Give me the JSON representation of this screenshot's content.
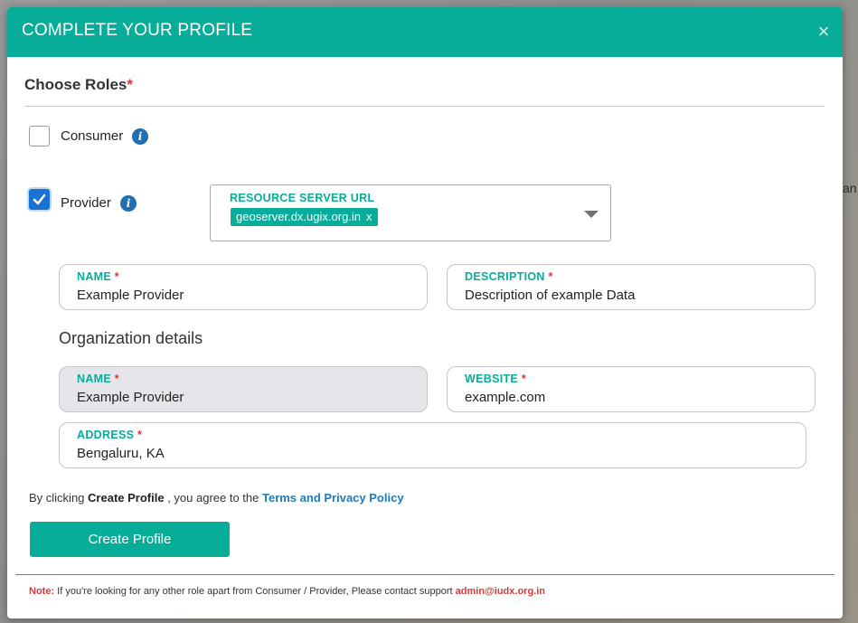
{
  "modal": {
    "title": "COMPLETE YOUR PROFILE",
    "close_icon": "×"
  },
  "background": {
    "peek_text": "an"
  },
  "roles": {
    "title": "Choose Roles",
    "required_mark": "*",
    "consumer": {
      "label": "Consumer",
      "checked": false,
      "info_icon": "i"
    },
    "provider": {
      "label": "Provider",
      "checked": true,
      "info_icon": "i"
    }
  },
  "resource_server": {
    "label": "RESOURCE SERVER URL",
    "selected_chip": "geoserver.dx.ugix.org.in",
    "chip_remove": "x"
  },
  "provider_fields": {
    "name": {
      "label": "NAME",
      "required": "*",
      "value": "Example Provider"
    },
    "description": {
      "label": "DESCRIPTION",
      "required": "*",
      "value": "Description of example Data"
    }
  },
  "organization": {
    "title": "Organization details",
    "name": {
      "label": "NAME",
      "required": "*",
      "value": "Example Provider"
    },
    "website": {
      "label": "WEBSITE",
      "required": "*",
      "value": "example.com"
    },
    "address": {
      "label": "ADDRESS",
      "required": "*",
      "value": "Bengaluru, KA"
    }
  },
  "agreement": {
    "prefix": "By clicking ",
    "action": "Create Profile",
    "middle": " , you agree to the ",
    "link": "Terms and Privacy Policy"
  },
  "create_button": {
    "label": "Create Profile"
  },
  "footer": {
    "note_label": "Note:",
    "note_text": " If you're looking for any other role apart from Consumer / Provider, Please contact support ",
    "email": "admin@iudx.org.in"
  },
  "colors": {
    "accent": "#07ad98",
    "required": "#d83a3a",
    "link": "#1f7ab8",
    "checkbox_checked": "#1a73d2"
  }
}
